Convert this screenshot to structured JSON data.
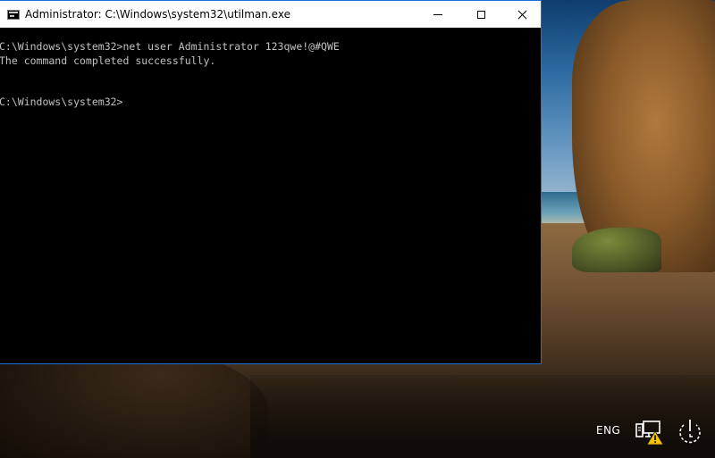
{
  "window": {
    "title": "Administrator: C:\\Windows\\system32\\utilman.exe",
    "icon": "console-icon",
    "controls": {
      "minimize": "minimize-icon",
      "maximize": "maximize-icon",
      "close": "close-icon"
    }
  },
  "console": {
    "lines": [
      "C:\\Windows\\system32>net user Administrator 123qwe!@#QWE",
      "The command completed successfully.",
      "",
      "",
      "C:\\Windows\\system32>"
    ],
    "text_color": "#c0c0c0",
    "background": "#000000"
  },
  "tray": {
    "language": "ENG",
    "network_icon": "network-warning-icon",
    "power_icon": "power-icon",
    "warning_color": "#f5c400"
  }
}
